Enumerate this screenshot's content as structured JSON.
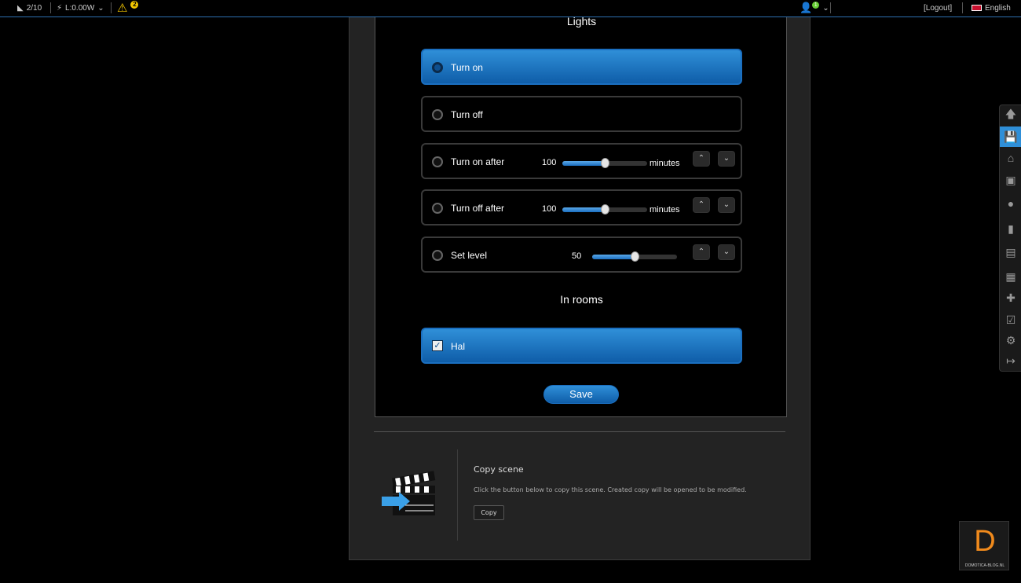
{
  "topbar": {
    "devices": "2/10",
    "power": "L:0.00W",
    "warnings_count": "2",
    "user_badge": "1",
    "logout": "[Logout]",
    "language": "English"
  },
  "lights": {
    "heading": "Lights",
    "options": [
      {
        "label": "Turn on",
        "selected": true
      },
      {
        "label": "Turn off",
        "selected": false
      },
      {
        "label": "Turn on after",
        "value": "100",
        "unit": "minutes",
        "level_fraction": 0.5
      },
      {
        "label": "Turn off after",
        "value": "100",
        "unit": "minutes",
        "level_fraction": 0.5
      },
      {
        "label": "Set level",
        "value": "50",
        "level_fraction": 0.5
      }
    ]
  },
  "rooms": {
    "heading": "In rooms",
    "items": [
      {
        "label": "Hal",
        "checked": true
      }
    ]
  },
  "save_label": "Save",
  "copy": {
    "title": "Copy scene",
    "description": "Click the button below to copy this scene. Created copy will be opened to be modified.",
    "button": "Copy"
  },
  "logo": {
    "letter": "D",
    "text": "DOMOTICA-BLOG.NL"
  },
  "colors": {
    "accent": "#1b6fc0",
    "logo_orange": "#f08a1c",
    "warning": "#f5c800"
  }
}
